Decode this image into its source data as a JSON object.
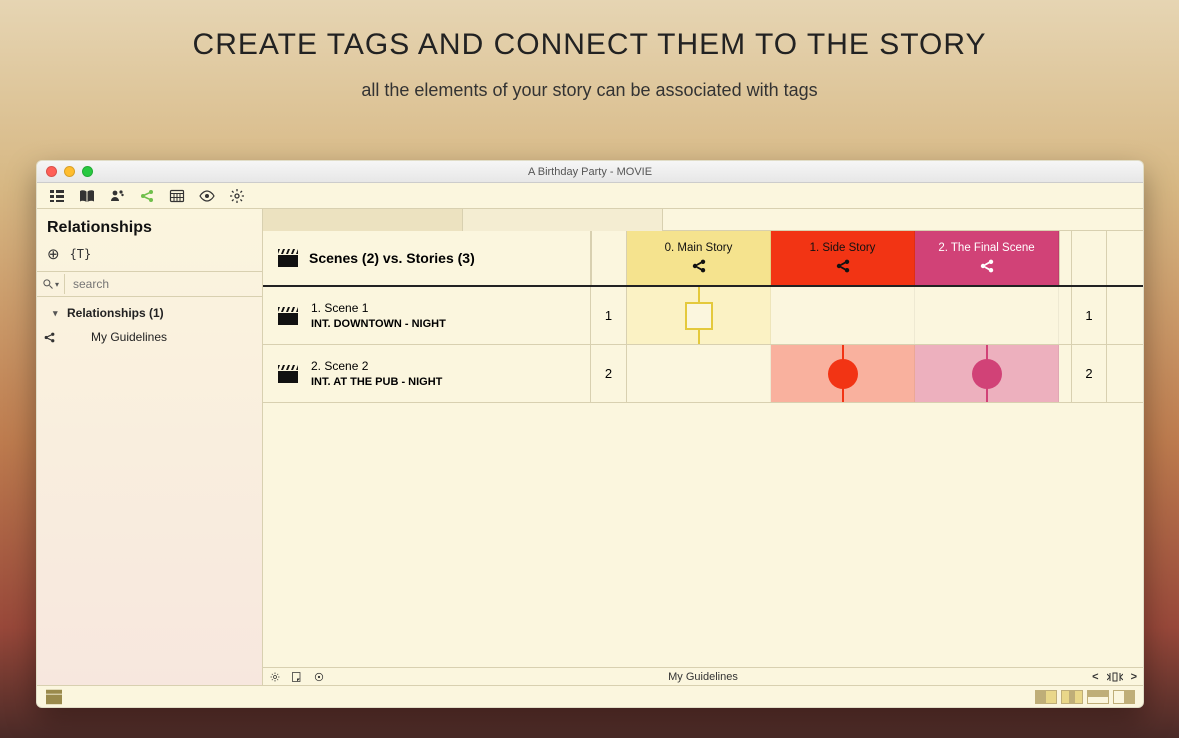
{
  "hero": {
    "title": "CREATE TAGS AND CONNECT THEM TO THE STORY",
    "subtitle": "all the elements of your story can be associated with tags"
  },
  "window": {
    "title": "A Birthday Party - MOVIE"
  },
  "sidebar": {
    "title": "Relationships",
    "add_brace": "{T}",
    "search_placeholder": "search",
    "tree": {
      "group": "Relationships (1)",
      "item": "My Guidelines"
    }
  },
  "grid": {
    "header_label": "Scenes (2) vs. Stories (3)",
    "stories": [
      {
        "label": "0. Main Story",
        "bg": "#F5E38E",
        "cellbg": "#FBF2C4",
        "dot": "#E4C93C",
        "icon_fill": "#111"
      },
      {
        "label": "1. Side Story",
        "bg": "#F23414",
        "cellbg": "#F9B19E",
        "dot": "#F23414",
        "icon_fill": "#111"
      },
      {
        "label": "2. The Final Scene",
        "bg": "#D14277",
        "cellbg": "#EDB0BE",
        "dot": "#D14277",
        "icon_fill": "#fff"
      }
    ],
    "scenes": [
      {
        "num": "1",
        "line1": "1.  Scene 1",
        "line2": "INT.  DOWNTOWN - NIGHT",
        "marks": [
          "square",
          null,
          null
        ]
      },
      {
        "num": "2",
        "line1": "2.  Scene 2",
        "line2": "INT.  AT THE PUB - NIGHT",
        "marks": [
          null,
          "circle",
          "circle"
        ]
      }
    ],
    "status_center": "My Guidelines"
  }
}
